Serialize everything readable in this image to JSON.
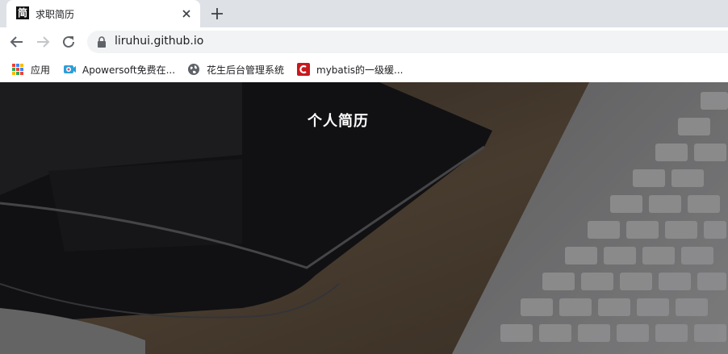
{
  "browser": {
    "tab": {
      "title": "求职简历",
      "favicon_text": "简"
    },
    "url": "liruhui.github.io",
    "bookmarks": [
      {
        "label": "应用",
        "icon": "apps-grid-icon"
      },
      {
        "label": "Apowersoft免费在...",
        "icon": "apowersoft-icon"
      },
      {
        "label": "花生后台管理系统",
        "icon": "globe-icon"
      },
      {
        "label": "mybatis的一级缓...",
        "icon": "csdn-icon"
      }
    ]
  },
  "page": {
    "title": "个人简历"
  },
  "colors": {
    "tabstrip": "#dee1e6",
    "omnibox": "#f1f3f4",
    "csdn_red": "#c9181e"
  }
}
